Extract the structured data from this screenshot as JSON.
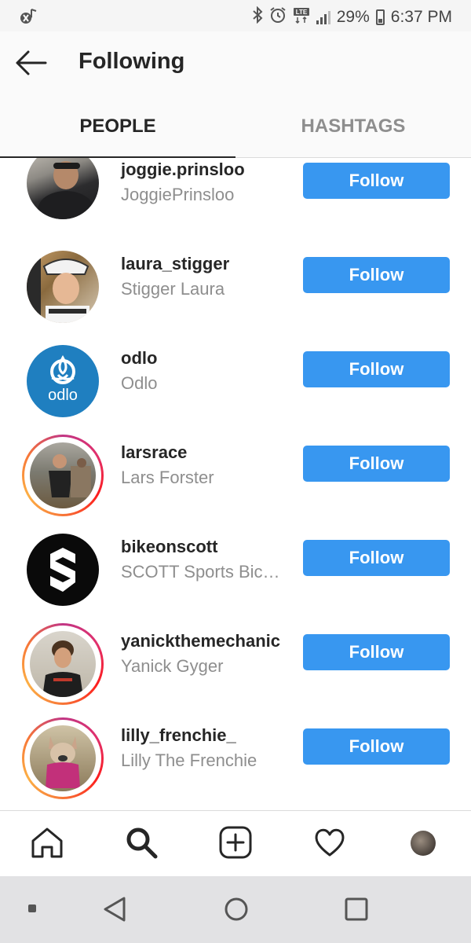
{
  "status_bar": {
    "time": "6:37 PM",
    "battery": "29%",
    "left_icon": "bluetooth-music-icon",
    "right_icons": [
      "bluetooth-icon",
      "alarm-icon",
      "lte-icon",
      "signal-icon",
      "battery-icon"
    ]
  },
  "header": {
    "title": "Following",
    "back_icon": "back-arrow-icon"
  },
  "tabs": [
    {
      "label": "PEOPLE",
      "active": true
    },
    {
      "label": "HASHTAGS",
      "active": false
    }
  ],
  "users": [
    {
      "username": "joggie.prinsloo",
      "full_name": "JoggiePrinsloo",
      "button": "Follow",
      "story_ring": false
    },
    {
      "username": "laura_stigger",
      "full_name": "Stigger Laura",
      "button": "Follow",
      "story_ring": false
    },
    {
      "username": "odlo",
      "full_name": "Odlo",
      "button": "Follow",
      "story_ring": false
    },
    {
      "username": "larsrace",
      "full_name": "Lars Forster",
      "button": "Follow",
      "story_ring": true
    },
    {
      "username": "bikeonscott",
      "full_name": "SCOTT Sports Bicycles",
      "button": "Follow",
      "story_ring": false
    },
    {
      "username": "yanickthemechanic",
      "full_name": "Yanick Gyger",
      "button": "Follow",
      "story_ring": true
    },
    {
      "username": "lilly_frenchie_",
      "full_name": "Lilly The Frenchie",
      "button": "Follow",
      "story_ring": true
    }
  ],
  "odlo_logo_text": "odlo",
  "bottom_nav": [
    "home-icon",
    "search-icon",
    "add-post-icon",
    "activity-heart-icon",
    "profile-avatar"
  ],
  "system_nav": [
    "recents-dot",
    "back-triangle-icon",
    "home-circle-icon",
    "overview-square-icon"
  ],
  "colors": {
    "follow_button": "#3897f0",
    "active_tab": "#262626",
    "inactive_tab": "#8e8e8e",
    "odlo_brand": "#1f7fc0"
  }
}
